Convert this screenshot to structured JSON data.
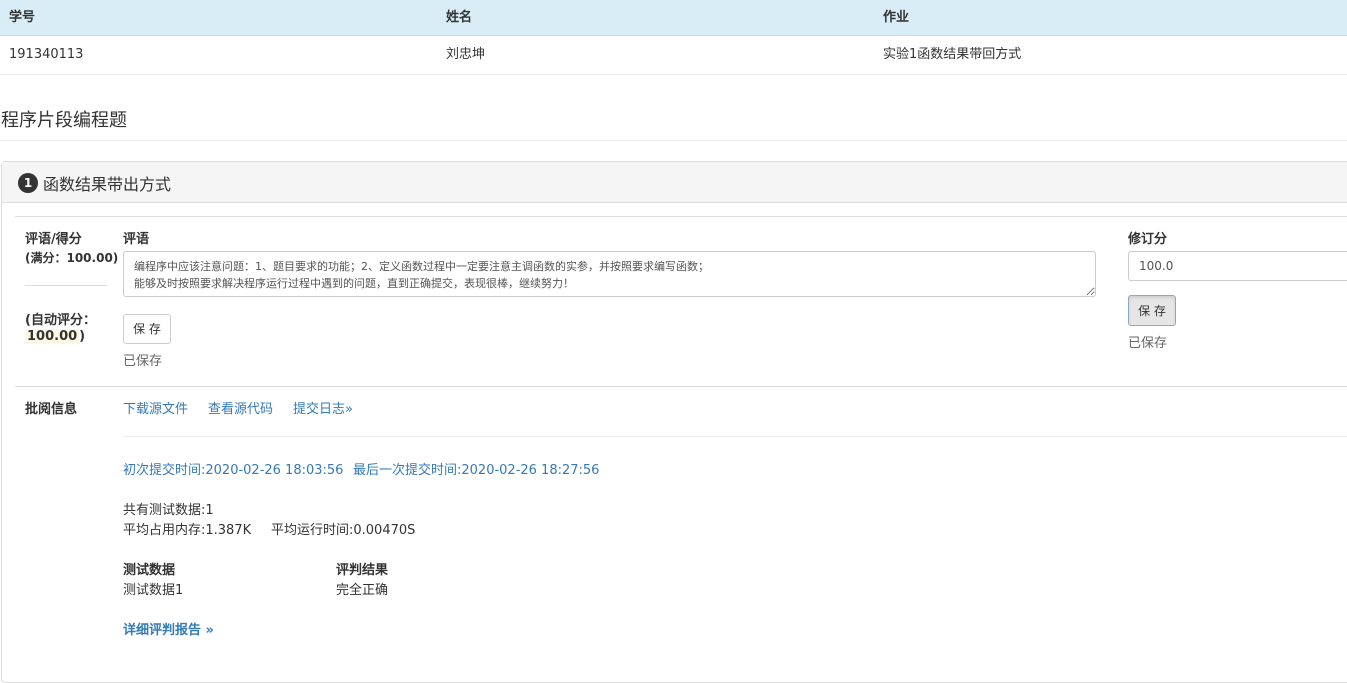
{
  "student_table": {
    "headers": [
      "学号",
      "姓名",
      "作业"
    ],
    "row": [
      "191340113",
      "刘忠坤",
      "实验1函数结果带回方式"
    ]
  },
  "section_title": "程序片段编程题",
  "problem": {
    "number": "1",
    "title": "函数结果带出方式"
  },
  "grading": {
    "score_label": "评语/得分",
    "full_score_label": "(满分：100.00)",
    "auto_label": "(自动评分：",
    "auto_value": "100.00",
    "auto_close": ")",
    "comment_label": "评语",
    "comment_line1": "编程序中应该注意问题：1、题目要求的功能；2、定义函数过程中一定要注意主调函数的实参，并按照要求编写函数；",
    "comment_line2": "能够及时按照要求解决程序运行过程中遇到的问题，直到正确提交，表现很棒，继续努力！",
    "save_label": "保 存",
    "saved_text": "已保存",
    "revise_label": "修订分",
    "revise_value": "100.0",
    "revise_save_label": "保 存",
    "revise_saved_text": "已保存"
  },
  "review": {
    "label": "批阅信息",
    "links": [
      "下载源文件",
      "查看源代码",
      "提交日志»"
    ],
    "first_submit": "初次提交时间:2020-02-26 18:03:56",
    "last_submit": "最后一次提交时间:2020-02-26 18:27:56",
    "test_count": "共有测试数据:1",
    "avg_memory": "平均占用内存:1.387K",
    "avg_time": "平均运行时间:0.00470S",
    "col_data": "测试数据",
    "col_result": "评判结果",
    "test_name": "测试数据1",
    "test_result": "完全正确",
    "detail_link": "详细评判报告 »"
  }
}
